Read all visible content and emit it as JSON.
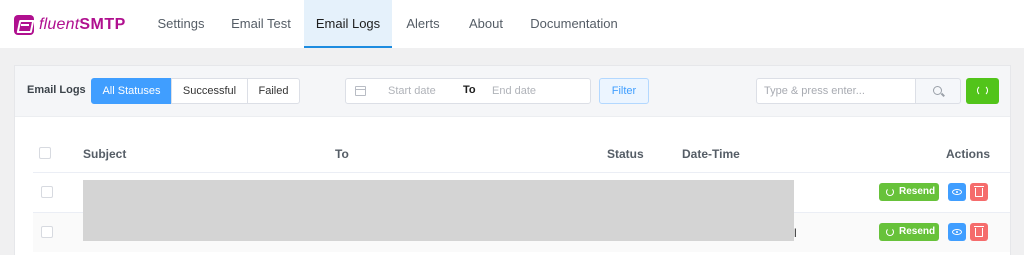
{
  "brand": {
    "name_light": "fluent",
    "name_bold": "SMTP"
  },
  "nav": {
    "tabs": [
      {
        "label": "Settings"
      },
      {
        "label": "Email Test"
      },
      {
        "label": "Email Logs",
        "active": true
      },
      {
        "label": "Alerts"
      },
      {
        "label": "About"
      },
      {
        "label": "Documentation"
      }
    ]
  },
  "toolbar": {
    "title": "Email Logs",
    "status_filters": [
      {
        "label": "All Statuses",
        "active": true
      },
      {
        "label": "Successful"
      },
      {
        "label": "Failed"
      }
    ],
    "date_range": {
      "start_placeholder": "Start date",
      "separator": "To",
      "end_placeholder": "End date"
    },
    "filter_label": "Filter",
    "search_placeholder": "Type & press enter..."
  },
  "table": {
    "columns": [
      "Subject",
      "To",
      "Status",
      "Date-Time",
      "Actions"
    ],
    "rows": [
      {
        "action_label": "Resend"
      },
      {
        "action_label": "Resend"
      }
    ],
    "stray_text": "l"
  },
  "colors": {
    "brand": "#b0108f",
    "primary": "#409eff",
    "success": "#67c23a",
    "danger": "#f56c6c",
    "active_tab_bg": "#e5f1fb"
  }
}
